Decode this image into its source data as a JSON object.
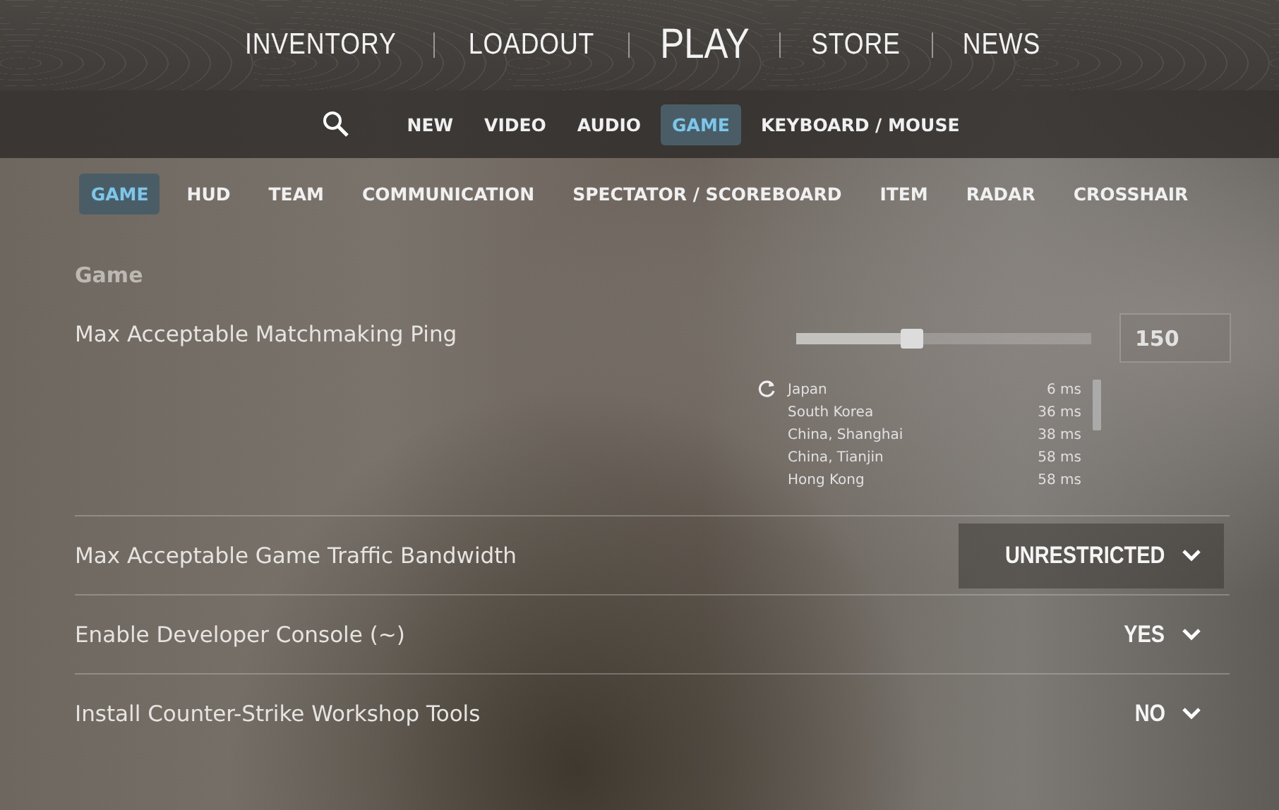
{
  "main_nav": [
    {
      "label": "INVENTORY",
      "selected": false
    },
    {
      "label": "LOADOUT",
      "selected": false
    },
    {
      "label": "PLAY",
      "selected": true
    },
    {
      "label": "STORE",
      "selected": false
    },
    {
      "label": "NEWS",
      "selected": false
    }
  ],
  "settings_tabs": [
    {
      "label": "NEW",
      "selected": false
    },
    {
      "label": "VIDEO",
      "selected": false
    },
    {
      "label": "AUDIO",
      "selected": false
    },
    {
      "label": "GAME",
      "selected": true
    },
    {
      "label": "KEYBOARD / MOUSE",
      "selected": false
    }
  ],
  "sub_tabs": [
    {
      "label": "GAME",
      "selected": true
    },
    {
      "label": "HUD",
      "selected": false
    },
    {
      "label": "TEAM",
      "selected": false
    },
    {
      "label": "COMMUNICATION",
      "selected": false
    },
    {
      "label": "SPECTATOR / SCOREBOARD",
      "selected": false
    },
    {
      "label": "ITEM",
      "selected": false
    },
    {
      "label": "RADAR",
      "selected": false
    },
    {
      "label": "CROSSHAIR",
      "selected": false
    }
  ],
  "section_title": "Game",
  "settings": [
    {
      "kind": "slider",
      "label": "Max Acceptable Matchmaking Ping",
      "level": 0.39,
      "value": "150",
      "regions": [
        {
          "name": "Japan",
          "ping": "6 ms"
        },
        {
          "name": "South Korea",
          "ping": "36 ms"
        },
        {
          "name": "China, Shanghai",
          "ping": "38 ms"
        },
        {
          "name": "China, Tianjin",
          "ping": "58 ms"
        },
        {
          "name": "Hong Kong",
          "ping": "58 ms"
        }
      ]
    },
    {
      "kind": "dropdown",
      "label": "Max Acceptable Game Traffic Bandwidth",
      "value": "UNRESTRICTED",
      "highlighted": true
    },
    {
      "kind": "dropdown",
      "label": "Enable Developer Console (~)",
      "value": "YES",
      "highlighted": false
    },
    {
      "kind": "dropdown",
      "label": "Install Counter-Strike Workshop Tools",
      "value": "NO",
      "highlighted": false
    }
  ]
}
